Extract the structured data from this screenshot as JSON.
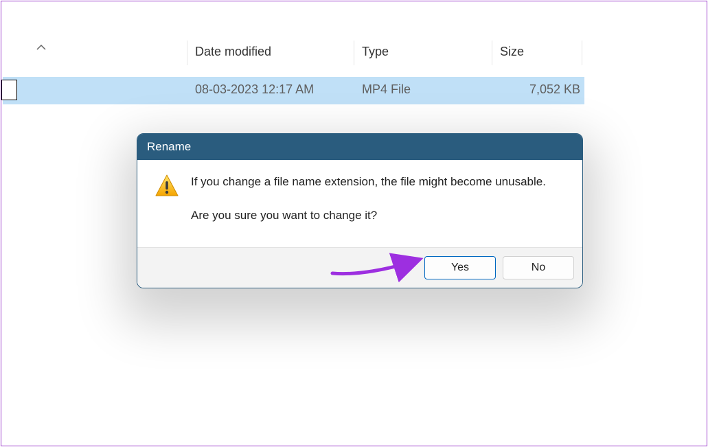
{
  "columns": {
    "date_modified": "Date modified",
    "type": "Type",
    "size": "Size"
  },
  "row": {
    "date_modified": "08-03-2023 12:17 AM",
    "type": "MP4 File",
    "size": "7,052 KB"
  },
  "dialog": {
    "title": "Rename",
    "message_line1": "If you change a file name extension, the file might become unusable.",
    "message_line2": "Are you sure you want to change it?",
    "yes_label": "Yes",
    "no_label": "No"
  }
}
